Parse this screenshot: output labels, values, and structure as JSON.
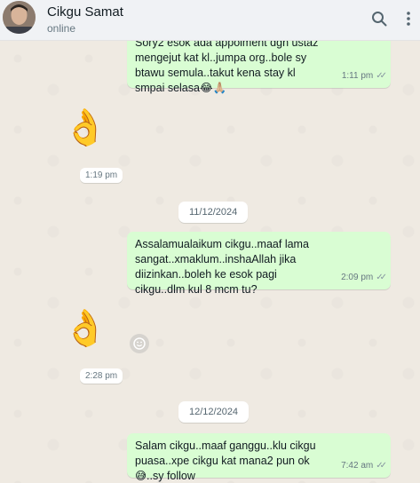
{
  "header": {
    "name": "Cikgu Samat",
    "status": "online",
    "search_icon": "search-icon",
    "menu_icon": "more-vertical-icon"
  },
  "messages": [
    {
      "type": "outgoing",
      "text": "Sory2 esok ada appoiment dgn ustaz mengejut kat kl..jumpa org..bole sy btawu semula..takut kena stay kl smpai selasa😂🙏🏼",
      "time": "1:11 pm",
      "status": "read"
    },
    {
      "type": "incoming-sticker",
      "emoji": "👌",
      "time": "1:19 pm"
    },
    {
      "type": "date",
      "label": "11/12/2024"
    },
    {
      "type": "outgoing",
      "text": "Assalamualaikum cikgu..maaf lama sangat..xmaklum..inshaAllah jika diizinkan..boleh ke esok pagi cikgu..dlm kul 8 mcm tu?",
      "time": "2:09 pm",
      "status": "read"
    },
    {
      "type": "incoming-sticker",
      "emoji": "👌",
      "time": "2:28 pm"
    },
    {
      "type": "date",
      "label": "12/12/2024"
    },
    {
      "type": "outgoing",
      "text": "Salam cikgu..maaf ganggu..klu cikgu puasa..xpe cikgu kat mana2 pun ok😅..sy follow",
      "time": "7:42 am",
      "status": "read"
    }
  ],
  "colors": {
    "outgoing_bubble": "#d9fdd3",
    "chat_bg": "#efeae2",
    "header_bg": "#f0f2f5",
    "tick_color": "#8696a0"
  }
}
